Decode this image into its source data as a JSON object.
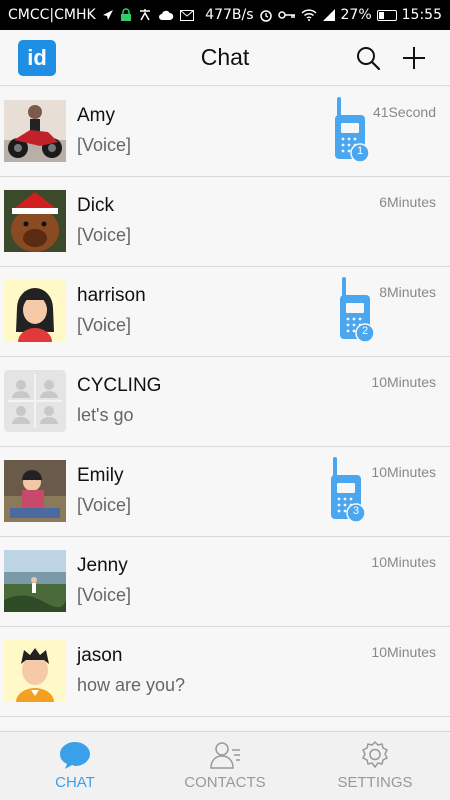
{
  "status_bar": {
    "carrier": "CMCC|CMHK",
    "speed": "477B/s",
    "battery": "27%",
    "time": "15:55"
  },
  "header": {
    "logo_text": "id",
    "title": "Chat"
  },
  "chats": [
    {
      "name": "Amy",
      "message": "[Voice]",
      "time": "41Second",
      "walkie_badge": "1"
    },
    {
      "name": "Dick",
      "message": "[Voice]",
      "time": "6Minutes",
      "walkie_badge": null
    },
    {
      "name": "harrison",
      "message": "[Voice]",
      "time": "8Minutes",
      "walkie_badge": "2"
    },
    {
      "name": "CYCLING",
      "message": "let's go",
      "time": "10Minutes",
      "walkie_badge": null
    },
    {
      "name": "Emily",
      "message": "[Voice]",
      "time": "10Minutes",
      "walkie_badge": "3"
    },
    {
      "name": "Jenny",
      "message": "[Voice]",
      "time": "10Minutes",
      "walkie_badge": null
    },
    {
      "name": "jason",
      "message": "how are you?",
      "time": "10Minutes",
      "walkie_badge": null
    }
  ],
  "tabs": [
    {
      "label": "CHAT",
      "icon": "chat-bubble-icon",
      "active": true
    },
    {
      "label": "CONTACTS",
      "icon": "contacts-icon",
      "active": false
    },
    {
      "label": "SETTINGS",
      "icon": "settings-gear-icon",
      "active": false
    }
  ],
  "colors": {
    "accent": "#3aa0ea",
    "walkie": "#4aa6ee",
    "logo": "#1f8fe6"
  }
}
